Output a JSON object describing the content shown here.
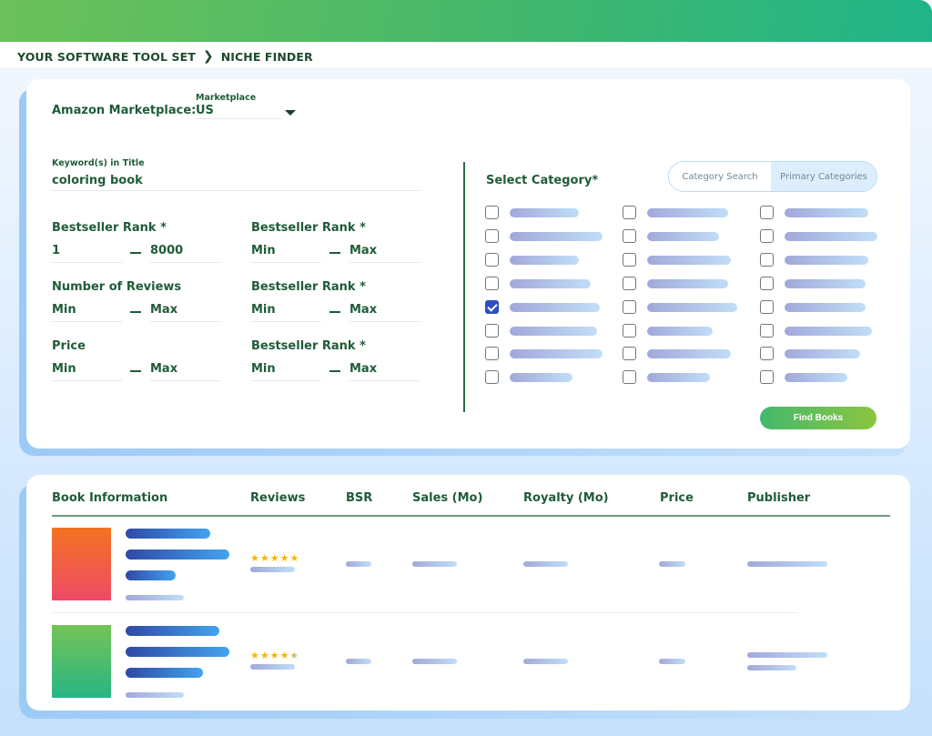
{
  "header": {
    "breadcrumb": [
      "YOUR SOFTWARE TOOL SET",
      "NICHE FINDER"
    ],
    "separator_icon": "chevron-right-icon"
  },
  "filters": {
    "marketplace": {
      "label": "Amazon Marketplace:",
      "field_label": "Marketplace",
      "value": "US"
    },
    "keyword": {
      "label": "Keyword(s) in Title",
      "value": "coloring book"
    },
    "ranges": [
      {
        "label": "Bestseller Rank *",
        "min": "1",
        "max": "8000",
        "min_is_placeholder": false
      },
      {
        "label": "Bestseller Rank *",
        "min": "Min",
        "max": "Max",
        "min_is_placeholder": true
      },
      {
        "label": "Number of Reviews",
        "min": "Min",
        "max": "Max",
        "min_is_placeholder": true
      },
      {
        "label": "Bestseller Rank *",
        "min": "Min",
        "max": "Max",
        "min_is_placeholder": true
      },
      {
        "label": "Price",
        "min": "Min",
        "max": "Max",
        "min_is_placeholder": true
      },
      {
        "label": "Bestseller Rank *",
        "min": "Min",
        "max": "Max",
        "min_is_placeholder": true
      }
    ],
    "separator": "—"
  },
  "category": {
    "label": "Select Category*",
    "tabs": [
      {
        "label": "Category Search",
        "active": false
      },
      {
        "label": "Primary Categories",
        "active": true
      }
    ],
    "checked_index": {
      "column": 0,
      "row": 4
    },
    "rows_per_column": 8,
    "columns": 3
  },
  "actions": {
    "find_books": "Find Books"
  },
  "results": {
    "columns": [
      "Book Information",
      "Reviews",
      "BSR",
      "Sales (Mo)",
      "Royalty (Mo)",
      "Price",
      "Publisher"
    ],
    "rows": [
      {
        "cover_colors": [
          "#f37321",
          "#ef4a67"
        ],
        "rating": 5
      },
      {
        "cover_colors": [
          "#74c455",
          "#27b585"
        ],
        "rating": 4.5
      }
    ]
  },
  "colors": {
    "brand_green": "#1f5c38",
    "accent_blue": "#2d4fbf",
    "star": "#f7b500"
  }
}
